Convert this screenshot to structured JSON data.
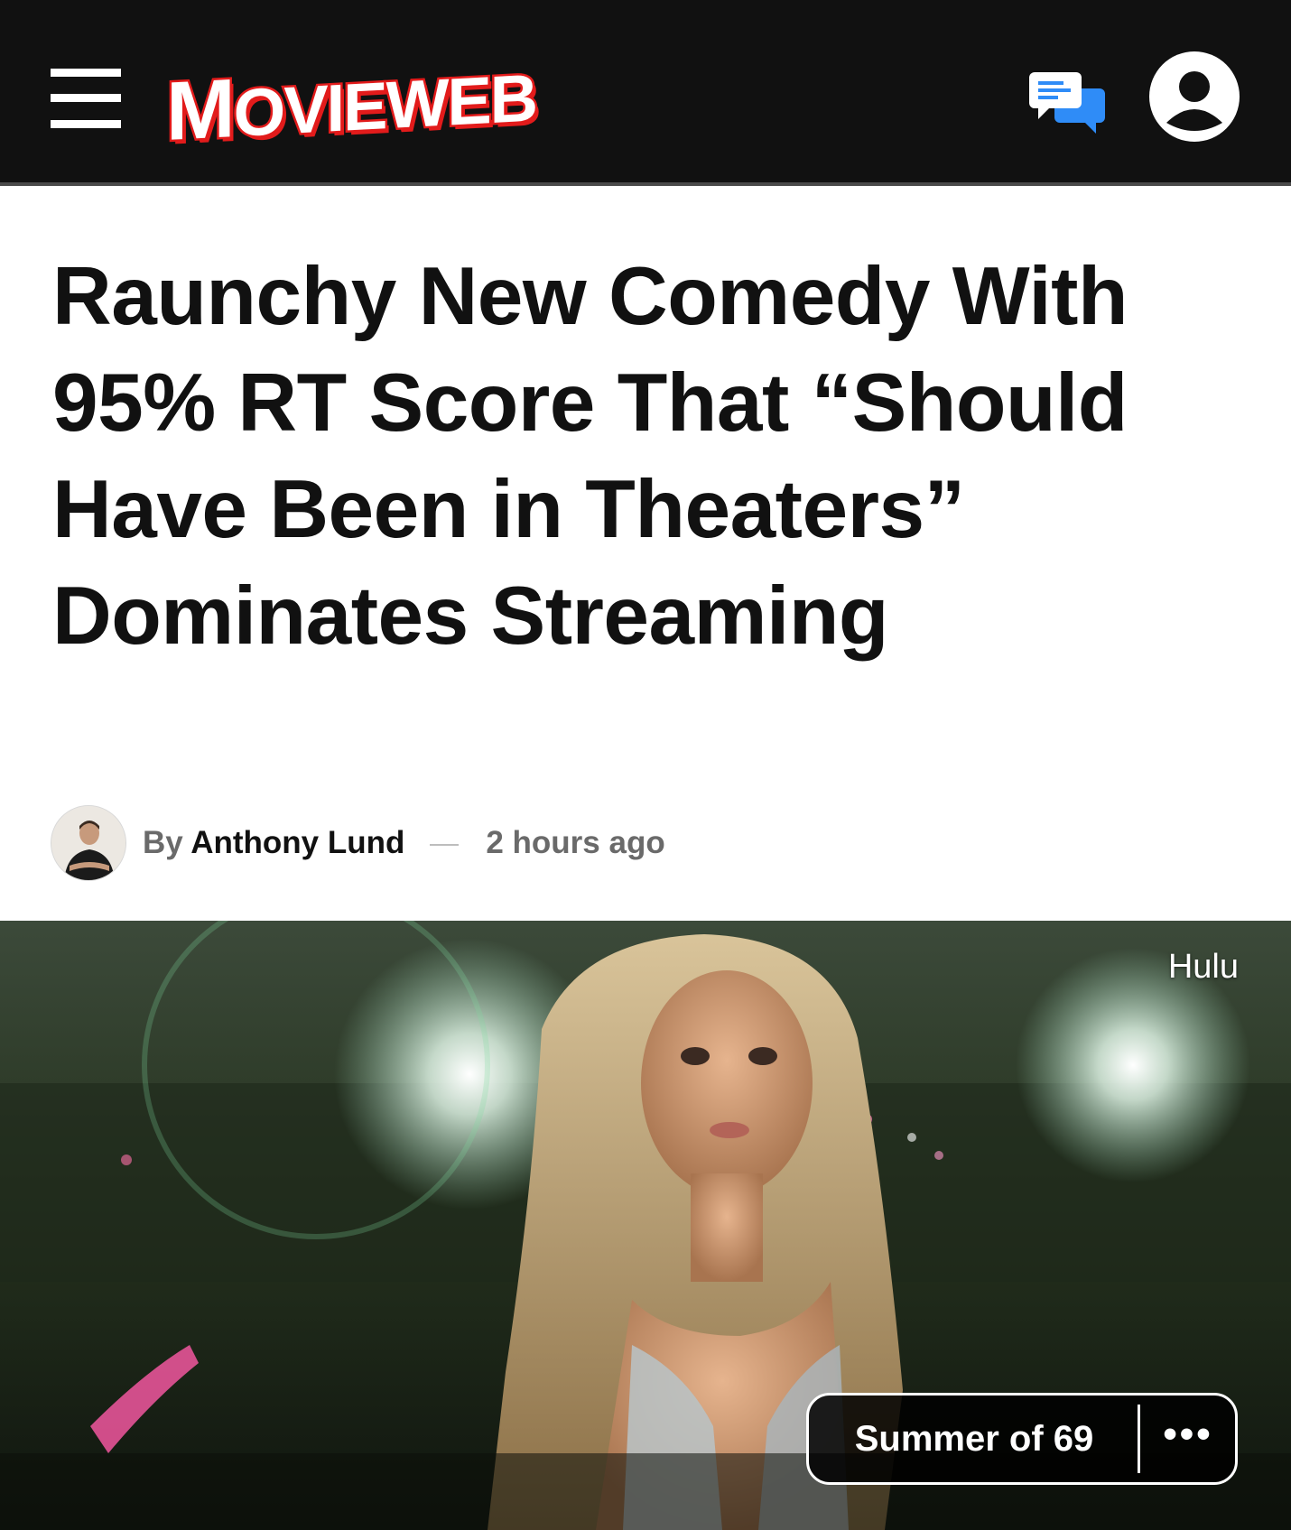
{
  "header": {
    "brand": "MovieWeb",
    "brand_first": "M",
    "brand_rest": "OVIEWEB",
    "menu_icon": "hamburger-menu-icon",
    "comments_icon": "chat-bubbles-icon",
    "account_icon": "user-avatar-icon",
    "colors": {
      "background": "#111111",
      "brand_red": "#e21b1b",
      "comments_blue": "#2f8cf7"
    }
  },
  "article": {
    "title": "Raunchy New Comedy With 95% RT Score That “Should Have Been in Theaters” Dominates Streaming",
    "byline_prefix": "By",
    "author": "Anthony Lund",
    "timestamp": "2 hours ago"
  },
  "hero": {
    "credit": "Hulu",
    "tag_label": "Summer of 69",
    "more_label": "•••"
  }
}
